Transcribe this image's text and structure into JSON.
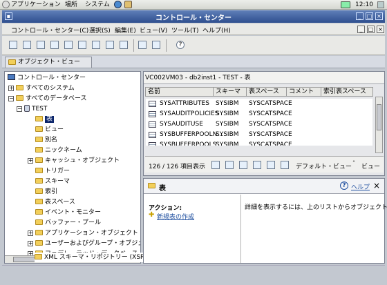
{
  "panel": {
    "applications": "アプリケーション",
    "places": "場所",
    "system": "システム",
    "clock": "12:10"
  },
  "window": {
    "title": "コントロール・センター"
  },
  "menu": {
    "items": [
      "コントロール・センター(C)",
      "選択(S)",
      "編集(E)",
      "ビュー(V)",
      "ツール(T)",
      "ヘルプ(H)"
    ]
  },
  "objview": {
    "tab_label": "オブジェクト・ビュー"
  },
  "tree": {
    "root": "コントロール・センター",
    "all_systems": "すべてのシステム",
    "all_databases": "すべてのデータベース",
    "db": "TEST",
    "items": [
      "表",
      "ビュー",
      "別名",
      "ニックネーム",
      "キャッシュ・オブジェクト",
      "トリガー",
      "スキーマ",
      "索引",
      "表スペース",
      "イベント・モニター",
      "バッファー・プール",
      "アプリケーション・オブジェクト",
      "ユーザーおよびグループ・オブジェ",
      "フェデレーテッド・データベース・",
      "XML スキーマ・リポジトリー (XSR"
    ]
  },
  "table": {
    "header": "VC002VM03 - db2inst1 - TEST - 表",
    "columns": [
      "名前",
      "スキーマ",
      "表スペース",
      "コメント",
      "索引表スペース"
    ],
    "rows": [
      [
        "SYSATTRIBUTES",
        "SYSIBM",
        "SYSCATSPACE"
      ],
      [
        "SYSAUDITPOLICIES",
        "SYSIBM",
        "SYSCATSPACE"
      ],
      [
        "SYSAUDITUSE",
        "SYSIBM",
        "SYSCATSPACE"
      ],
      [
        "SYSBUFFERPOOLN...",
        "SYSIBM",
        "SYSCATSPACE"
      ],
      [
        "SYSBUFFERPOOLS",
        "SYSIBM",
        "SYSCATSPACE"
      ]
    ],
    "count": "126 / 126 項目表示",
    "default_view": "デフォルト・ビュー",
    "view": "ビュー"
  },
  "details": {
    "title": "表",
    "help": "ヘルプ",
    "actions_label": "アクション:",
    "create_new": "新規表の作成",
    "hint": "詳細を表示するには、上のリストからオブジェクトを選"
  }
}
